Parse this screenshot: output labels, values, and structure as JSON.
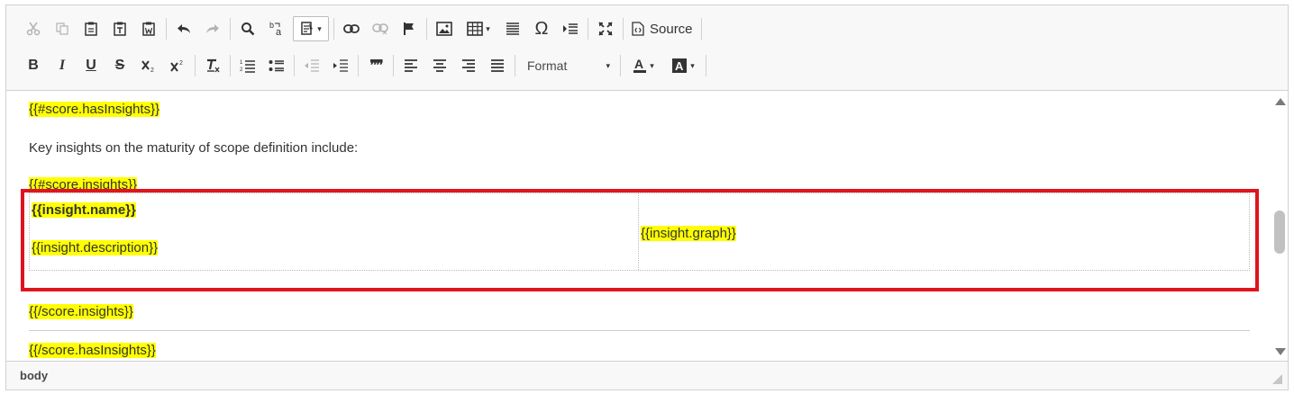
{
  "toolbar": {
    "source_label": "Source",
    "format_label": "Format",
    "bold_glyph": "B",
    "italic_glyph": "I",
    "underline_glyph": "U",
    "strike_glyph": "S",
    "omega_glyph": "Ω",
    "quote_glyph": "❞❞"
  },
  "content": {
    "line1": "{{#score.hasInsights}}",
    "paragraph": "Key insights on the maturity of scope definition include:",
    "line2": "{{#score.insights}}",
    "cell_name": "{{insight.name}}",
    "cell_description": "{{insight.description}}",
    "cell_graph": "{{insight.graph}}",
    "line3": "{{/score.insights}}",
    "line4": "{{/score.hasInsights}}"
  },
  "statusbar": {
    "path": "body"
  },
  "colors": {
    "highlight": "#ffff00",
    "annotation_box": "#e0141e"
  }
}
